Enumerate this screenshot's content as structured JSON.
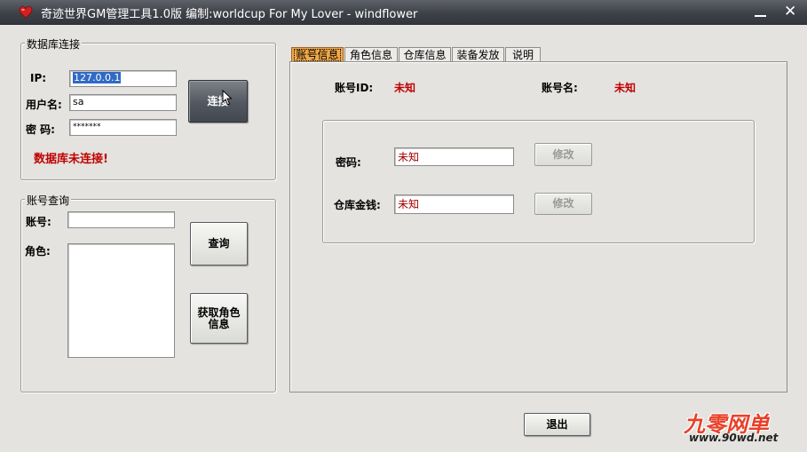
{
  "window": {
    "title": "奇迹世界GM管理工具1.0版  编制:worldcup For My Lover - windflower",
    "minimize_icon": "minimize-icon",
    "close_icon": "close-icon"
  },
  "db_group": {
    "legend": "数据库连接",
    "ip_label": "IP:",
    "ip_value": "127.0.0.1",
    "user_label": "用户名:",
    "user_value": "sa",
    "pwd_label": "密  码:",
    "pwd_value": "*******",
    "connect_label": "连接",
    "status": "数据库未连接!"
  },
  "query_group": {
    "legend": "账号查询",
    "account_label": "账号:",
    "account_value": "",
    "role_label": "角色:",
    "query_label": "查询",
    "get_role_label": "获取角色信息"
  },
  "tabs": [
    {
      "label": "账号信息",
      "active": true
    },
    {
      "label": "角色信息",
      "active": false
    },
    {
      "label": "仓库信息",
      "active": false
    },
    {
      "label": "装备发放",
      "active": false
    },
    {
      "label": "说明",
      "active": false
    }
  ],
  "account_tab": {
    "id_label": "账号ID:",
    "id_value": "未知",
    "name_label": "账号名:",
    "name_value": "未知",
    "password_label": "密码:",
    "password_value": "未知",
    "password_modify": "修改",
    "money_label": "仓库金钱:",
    "money_value": "未知",
    "money_modify": "修改"
  },
  "exit_label": "退出",
  "watermark": {
    "logo": "九零网单",
    "url": "www.90wd.net"
  },
  "colors": {
    "titlebar": "#3e4248",
    "window_bg": "#e4e3df",
    "active_tab": "#f0a848",
    "value_red": "#c00000"
  }
}
